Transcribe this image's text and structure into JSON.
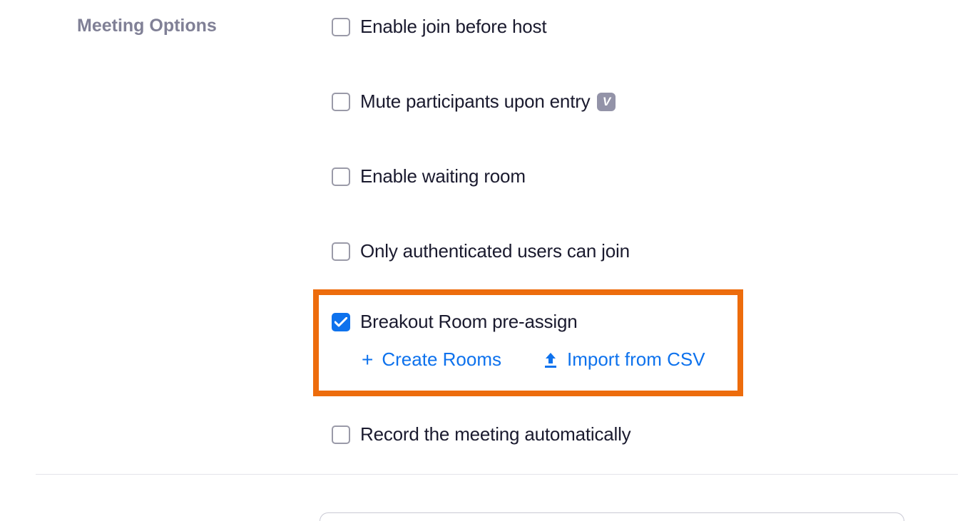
{
  "section": {
    "title": "Meeting Options"
  },
  "options": {
    "enable_join_before_host": {
      "label": "Enable join before host",
      "checked": false
    },
    "mute_participants": {
      "label": "Mute participants upon entry",
      "checked": false,
      "info_badge": "V"
    },
    "waiting_room": {
      "label": "Enable waiting room",
      "checked": false
    },
    "authenticated_users": {
      "label": "Only authenticated users can join",
      "checked": false
    },
    "breakout_room": {
      "label": "Breakout Room pre-assign",
      "checked": true,
      "actions": {
        "create_rooms": "Create Rooms",
        "import_csv": "Import from CSV"
      }
    },
    "record_auto": {
      "label": "Record the meeting automatically",
      "checked": false
    }
  }
}
